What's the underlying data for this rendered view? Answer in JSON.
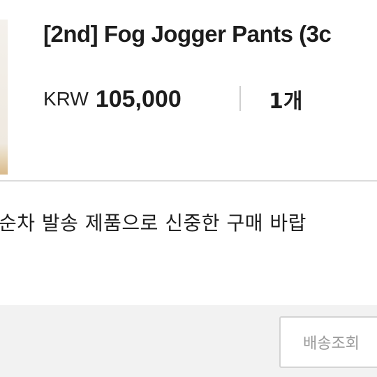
{
  "product": {
    "title": "[2nd] Fog Jogger Pants (3c",
    "currency": "KRW",
    "price": "105,000",
    "quantity": "1개"
  },
  "notice": "순차 발송 제품으로 신중한 구매 바랍",
  "footer": {
    "track_button_label": "배송조회"
  }
}
